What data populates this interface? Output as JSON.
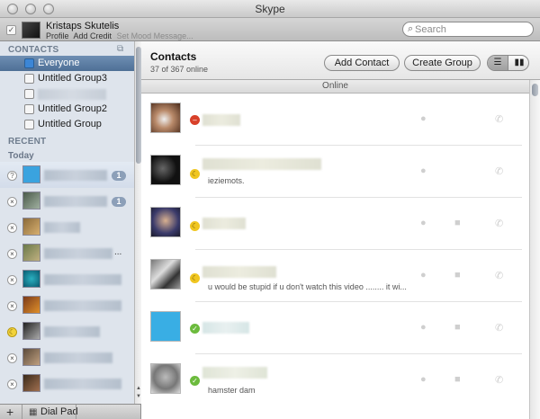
{
  "window": {
    "title": "Skype"
  },
  "account": {
    "name": "Kristaps Skutelis",
    "links": [
      "Profile",
      "Add Credit"
    ],
    "mood_placeholder": "Set Mood Message..."
  },
  "search": {
    "placeholder": "Search"
  },
  "sidebar": {
    "contacts_header": "CONTACTS",
    "groups": [
      {
        "label": "Everyone",
        "selected": true
      },
      {
        "label": "Untitled Group3",
        "selected": false
      },
      {
        "label": "",
        "selected": false
      },
      {
        "label": "Untitled Group2",
        "selected": false
      },
      {
        "label": "Untitled Group",
        "selected": false
      }
    ],
    "recent_header": "RECENT",
    "today_label": "Today",
    "recent": [
      {
        "badge": "1"
      },
      {
        "badge": "1"
      },
      {
        "badge": ""
      },
      {
        "badge": "",
        "ellipsis": "..."
      },
      {
        "badge": ""
      },
      {
        "badge": ""
      },
      {
        "badge": ""
      },
      {
        "badge": ""
      },
      {
        "badge": ""
      }
    ]
  },
  "bottom_bar": {
    "add_glyph": "+",
    "dial_pad_label": "Dial Pad"
  },
  "main": {
    "title": "Contacts",
    "online_count": "37 of 367 online",
    "add_contact_label": "Add Contact",
    "create_group_label": "Create Group",
    "section_online": "Online",
    "contacts": [
      {
        "mood": "",
        "status": "red"
      },
      {
        "mood": "ieziemots.",
        "status": "yellow"
      },
      {
        "mood": "",
        "status": "yellow"
      },
      {
        "mood": "u would be stupid if u don't watch this video ........ it wi...",
        "status": "yellow"
      },
      {
        "mood": "",
        "status": "green"
      },
      {
        "mood": "hamster dam",
        "status": "green"
      }
    ]
  },
  "colors": {
    "sidebar_bg": "#dee4ec",
    "selected_row": "#5c7ca3",
    "status_online": "#6cbb3d",
    "status_away": "#f0c620",
    "status_busy": "#d8402a"
  }
}
